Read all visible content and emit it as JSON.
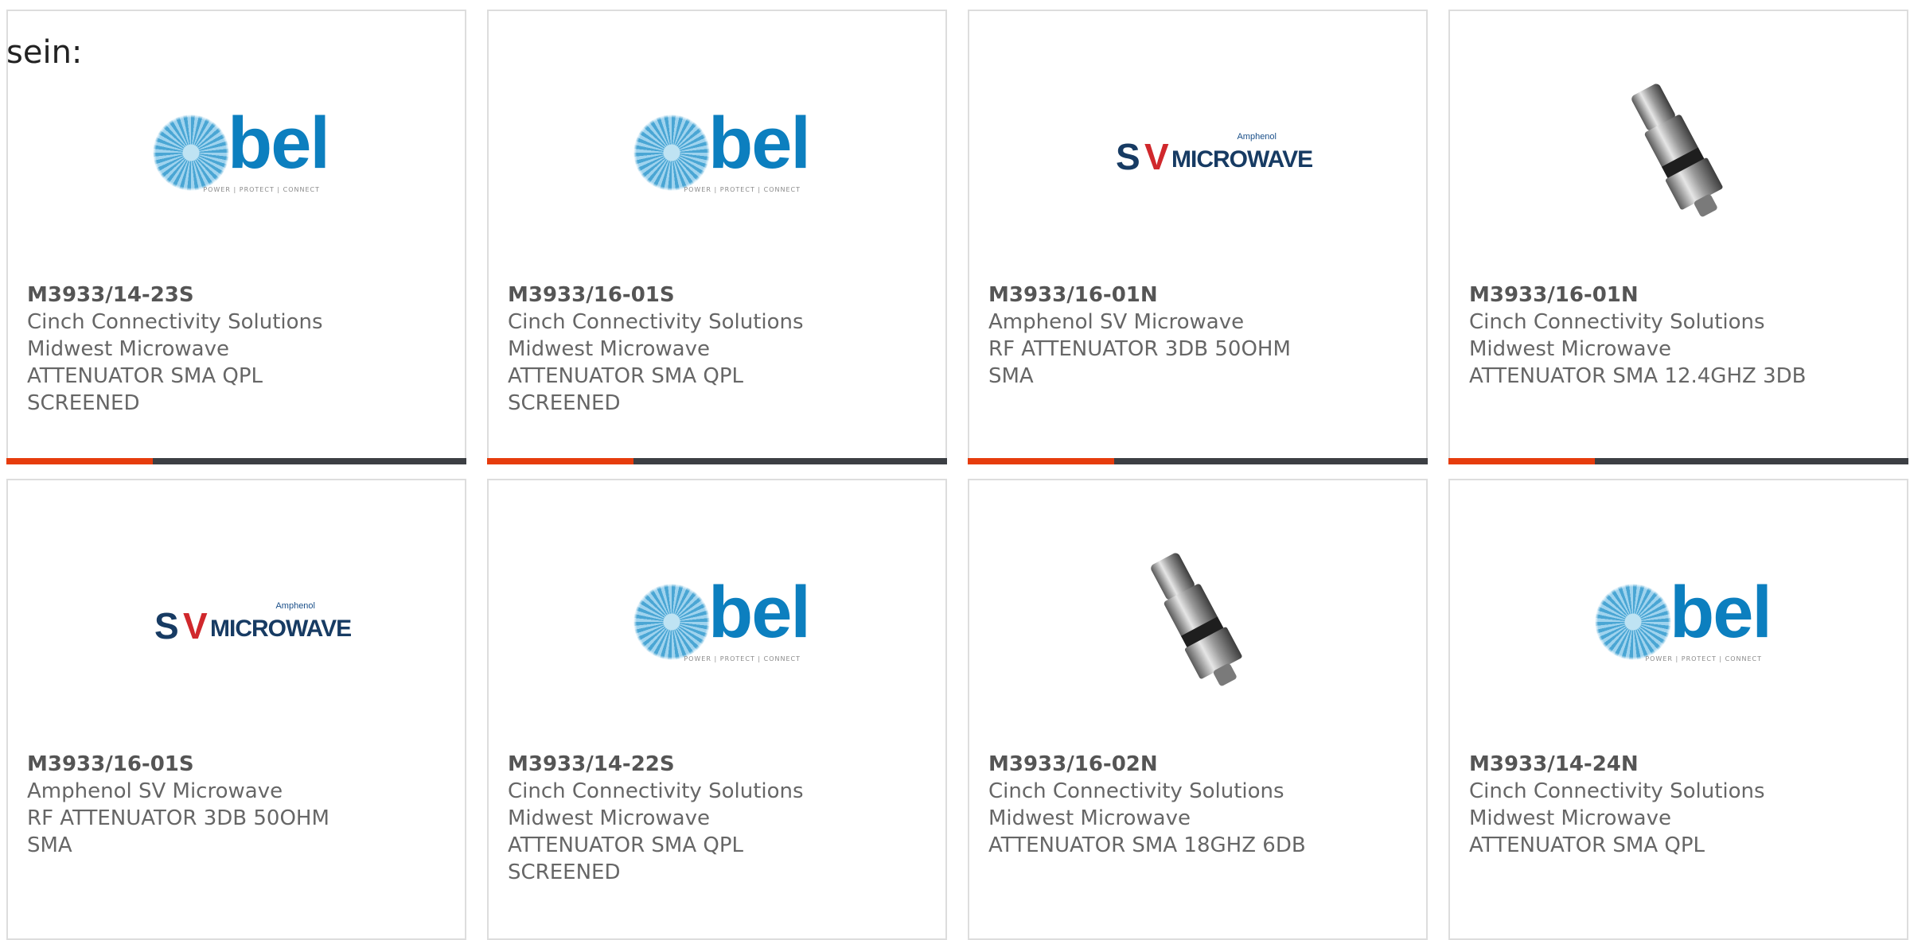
{
  "intro_text": "sein:",
  "colors": {
    "accent": "#e63c0d",
    "bar_dark": "#3c3f44",
    "bel_blue": "#0c7fbf",
    "sv_navy": "#173b63",
    "sv_red": "#d0282c"
  },
  "logos": {
    "bel": {
      "word": "bel",
      "tagline": "POWER | PROTECT | CONNECT"
    },
    "sv": {
      "top": "Amphenol",
      "s": "S",
      "v": "V",
      "word": "MICROWAVE"
    }
  },
  "cards": [
    {
      "image": "bel-logo",
      "part_number": "M3933/14-23S",
      "lines": [
        "Cinch Connectivity Solutions",
        "Midwest Microwave",
        "ATTENUATOR SMA QPL",
        "SCREENED"
      ]
    },
    {
      "image": "bel-logo",
      "part_number": "M3933/16-01S",
      "lines": [
        "Cinch Connectivity Solutions",
        "Midwest Microwave",
        "ATTENUATOR SMA QPL",
        "SCREENED"
      ]
    },
    {
      "image": "sv-microwave-logo",
      "part_number": "M3933/16-01N",
      "lines": [
        "Amphenol SV Microwave",
        "RF ATTENUATOR 3DB 50OHM",
        "SMA",
        ""
      ]
    },
    {
      "image": "attenuator-photo",
      "part_number": "M3933/16-01N",
      "lines": [
        "Cinch Connectivity Solutions",
        "Midwest Microwave",
        "ATTENUATOR SMA 12.4GHZ 3DB",
        ""
      ]
    },
    {
      "image": "sv-microwave-logo",
      "part_number": "M3933/16-01S",
      "lines": [
        "Amphenol SV Microwave",
        "RF ATTENUATOR 3DB 50OHM",
        "SMA",
        ""
      ]
    },
    {
      "image": "bel-logo",
      "part_number": "M3933/14-22S",
      "lines": [
        "Cinch Connectivity Solutions",
        "Midwest Microwave",
        "ATTENUATOR SMA QPL",
        "SCREENED"
      ]
    },
    {
      "image": "attenuator-photo",
      "part_number": "M3933/16-02N",
      "lines": [
        "Cinch Connectivity Solutions",
        "Midwest Microwave",
        "ATTENUATOR SMA 18GHZ 6DB",
        ""
      ]
    },
    {
      "image": "bel-logo",
      "part_number": "M3933/14-24N",
      "lines": [
        "Cinch Connectivity Solutions",
        "Midwest Microwave",
        "ATTENUATOR SMA QPL",
        ""
      ]
    }
  ]
}
